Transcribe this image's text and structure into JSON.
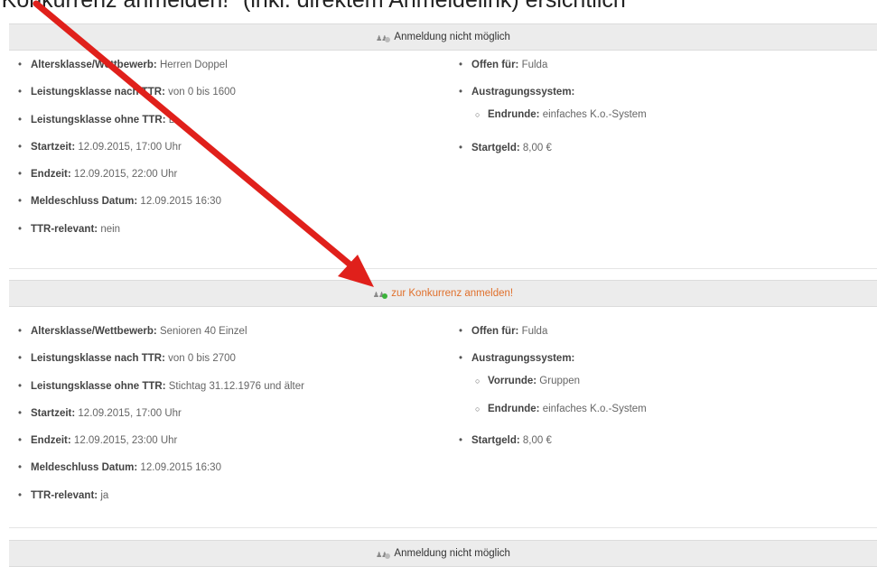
{
  "caption": "zur Konkurrenz anmelden!\" (inkl. direktem Anmeldelink) ersichtlich",
  "colors": {
    "bar_bg": "#ececec",
    "link": "#e0702c",
    "arrow": "#e0201b",
    "icon_dot_ok": "#3bb33b",
    "icon_dot_closed": "#bbbbbb"
  },
  "comp1": {
    "header": "Anmeldung nicht möglich",
    "left": [
      {
        "label": "Altersklasse/Wettbewerb:",
        "value": " Herren Doppel"
      },
      {
        "label": "Leistungsklasse nach TTR:",
        "value": " von 0 bis 1600"
      },
      {
        "label": "Leistungsklasse ohne TTR:",
        "value": " D"
      },
      {
        "label": "Startzeit:",
        "value": " 12.09.2015, 17:00 Uhr"
      },
      {
        "label": "Endzeit:",
        "value": " 12.09.2015, 22:00 Uhr"
      },
      {
        "label": "Meldeschluss Datum:",
        "value": " 12.09.2015 16:30"
      },
      {
        "label": "TTR-relevant:",
        "value": " nein"
      }
    ],
    "right": {
      "offen": {
        "label": "Offen für:",
        "value": " Fulda"
      },
      "system": {
        "label": "Austragungssystem:"
      },
      "sub": [
        {
          "label": "Endrunde:",
          "value": " einfaches K.o.-System"
        }
      ],
      "startgeld": {
        "label": "Startgeld:",
        "value": " 8,00 €"
      }
    }
  },
  "comp2": {
    "header": "zur Konkurrenz anmelden!",
    "left": [
      {
        "label": "Altersklasse/Wettbewerb:",
        "value": " Senioren 40 Einzel"
      },
      {
        "label": "Leistungsklasse nach TTR:",
        "value": " von 0 bis 2700"
      },
      {
        "label": "Leistungsklasse ohne TTR:",
        "value": " Stichtag 31.12.1976 und älter"
      },
      {
        "label": "Startzeit:",
        "value": " 12.09.2015, 17:00 Uhr"
      },
      {
        "label": "Endzeit:",
        "value": " 12.09.2015, 23:00 Uhr"
      },
      {
        "label": "Meldeschluss Datum:",
        "value": " 12.09.2015 16:30"
      },
      {
        "label": "TTR-relevant:",
        "value": " ja"
      }
    ],
    "right": {
      "offen": {
        "label": "Offen für:",
        "value": " Fulda"
      },
      "system": {
        "label": "Austragungssystem:"
      },
      "sub": [
        {
          "label": "Vorrunde:",
          "value": " Gruppen"
        },
        {
          "label": "Endrunde:",
          "value": " einfaches K.o.-System"
        }
      ],
      "startgeld": {
        "label": "Startgeld:",
        "value": " 8,00 €"
      }
    }
  },
  "comp3": {
    "header": "Anmeldung nicht möglich"
  },
  "bullets": {
    "main": "•",
    "sub": "○"
  }
}
